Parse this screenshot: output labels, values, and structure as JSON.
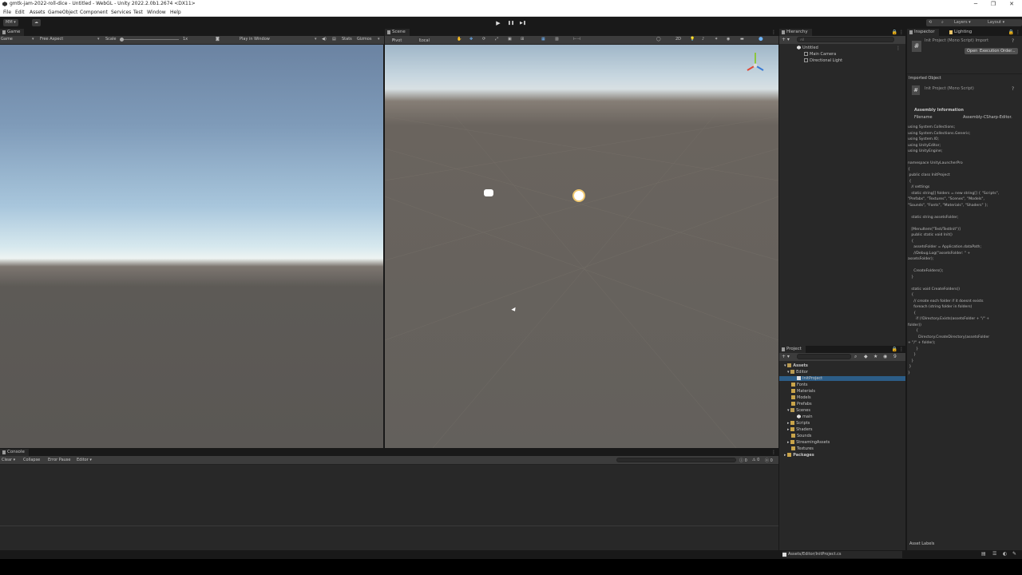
{
  "window": {
    "title": "gmtk-jam-2022-roll-dice - Untitled - WebGL - Unity 2022.2.0b1.2674 <DX11>",
    "minimize": "─",
    "maximize": "❐",
    "close": "✕"
  },
  "menu": [
    "File",
    "Edit",
    "Assets",
    "GameObject",
    "Component",
    "Services",
    "Test",
    "Window",
    "Help"
  ],
  "toolbar": {
    "account": "MM",
    "cloud": "☁",
    "play": "▶",
    "pause": "❚❚",
    "step": "▶❚",
    "layers": "Layers",
    "layout": "Layout"
  },
  "game": {
    "tab": "Game",
    "display": "Game",
    "aspect": "Free Aspect",
    "scale_label": "Scale",
    "scale_value": "1x",
    "play_mode": "Play in Window",
    "stats": "Stats",
    "gizmos": "Gizmos"
  },
  "scene": {
    "tab": "Scene",
    "pivot": "Pivot",
    "local": "Local",
    "mode_2d": "2D"
  },
  "hierarchy": {
    "tab": "Hierarchy",
    "search_placeholder": "All",
    "items": [
      "Untitled",
      "Main Camera",
      "Directional Light"
    ]
  },
  "project": {
    "tab": "Project",
    "tree": {
      "assets": "Assets",
      "editor": "Editor",
      "init_project": "InitProject",
      "fonts": "Fonts",
      "materials": "Materials",
      "models": "Models",
      "prefabs": "Prefabs",
      "scenes": "Scenes",
      "main": "main",
      "scripts": "Scripts",
      "shaders": "Shaders",
      "sounds": "Sounds",
      "streaming_assets": "StreamingAssets",
      "textures": "Textures",
      "packages": "Packages"
    },
    "status_path": "Assets/Editor/InitProject.cs",
    "hidden_count": "9"
  },
  "inspector": {
    "tab": "Inspector",
    "lighting_tab": "Lighting",
    "title": "Init Project (Mono Script) Import",
    "open_button": "Open",
    "execution_order_button": "Execution Order...",
    "imported_object": "Imported Object",
    "script_title": "Init Project (Mono Script)",
    "assembly_information": "Assembly Information",
    "filename_label": "Filename",
    "filename_value": "Assembly-CSharp-Editor.",
    "asset_labels": "Asset Labels",
    "code": [
      "using System.Collections;",
      "using System.Collections.Generic;",
      "using System.IO;",
      "using UnityEditor;",
      "using UnityEngine;",
      "",
      "namespace UnityLauncherPro",
      "{",
      "    public class InitProject",
      "    {",
      "        // settings",
      "        static string[] folders = new string[] { \"Scripts\",",
      "\"Prefabs\", \"Textures\", \"Scenes\", \"Models\",",
      "\"Sounds\", \"Fonts\", \"Materials\", \"Shaders\" };",
      "",
      "        static string assetsFolder;",
      "",
      "        [MenuItem(\"Test/TestInit\")]",
      "        public static void Init()",
      "        {",
      "            assetsFolder = Application.dataPath;",
      "            //Debug.Log(\"assetsFolder: \" +",
      "assetsFolder);",
      "",
      "            CreateFolders();",
      "        }",
      "",
      "        static void CreateFolders()",
      "        {",
      "            // create each folder if it doesnt exists",
      "            foreach (string folder in folders)",
      "            {",
      "                if (!Directory.Exists(assetsFolder + \"/\" +",
      "folder))",
      "                {",
      "                    Directory.CreateDirectory(assetsFolder",
      "+ \"/\" + folder);",
      "                }",
      "            }",
      "        }",
      "    }",
      "}"
    ]
  },
  "console": {
    "tab": "Console",
    "clear": "Clear",
    "collapse": "Collapse",
    "error_pause": "Error Pause",
    "editor": "Editor",
    "count_log": "0",
    "count_warn": "0",
    "count_error": "0"
  }
}
